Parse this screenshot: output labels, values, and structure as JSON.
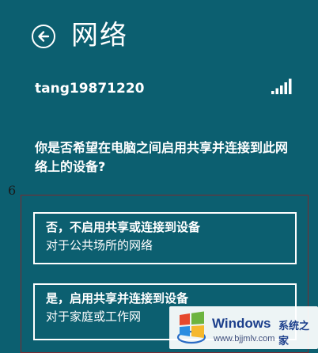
{
  "header": {
    "title": "网络",
    "back_icon": "back-arrow-circle-icon"
  },
  "network": {
    "name": "tang19871220",
    "signal_icon": "wifi-signal-icon"
  },
  "prompt": {
    "question": "你是否希望在电脑之间启用共享并连接到此网络上的设备?"
  },
  "annotation": {
    "number": "6",
    "color": "#7a2a30"
  },
  "options": [
    {
      "title": "否，不启用共享或连接到设备",
      "subtitle": "对于公共场所的网络"
    },
    {
      "title": "是，启用共享并连接到设备",
      "subtitle": "对于家庭或工作网"
    }
  ],
  "watermark": {
    "brand": "Windows",
    "cn_text": "系统之家",
    "url": "www.bjjmlv.com"
  },
  "colors": {
    "background": "#0c5f70",
    "foreground": "#ffffff"
  }
}
